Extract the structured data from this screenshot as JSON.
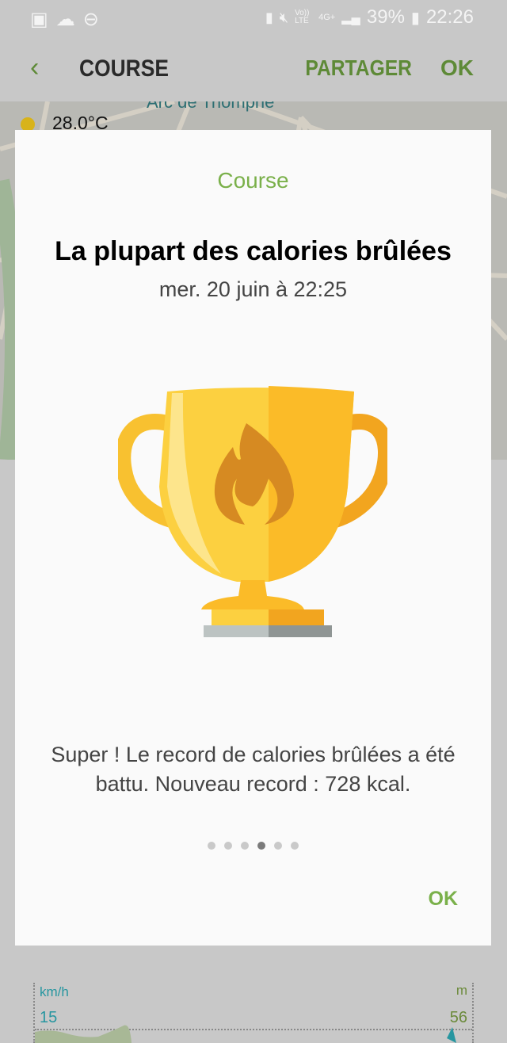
{
  "status_bar": {
    "battery": "39%",
    "time": "22:26",
    "network": "4G+",
    "volte": "Vo)) LTE",
    "icons": [
      "gallery-icon",
      "cloud-icon",
      "dnd-icon",
      "battery-saver-icon",
      "mute-icon",
      "signal-icon",
      "battery-icon"
    ]
  },
  "app_bar": {
    "title": "COURSE",
    "share": "PARTAGER",
    "ok": "OK"
  },
  "map": {
    "temperature": "28.0°C",
    "label": "Arc de Triomphe"
  },
  "dialog": {
    "category": "Course",
    "heading": "La plupart des calories brûlées",
    "date": "mer. 20 juin à 22:25",
    "message": "Super ! Le record de calories brûlées a été battu. Nouveau record : 728 kcal.",
    "ok": "OK",
    "page_count": 6,
    "active_page": 4
  },
  "chart": {
    "left_unit": "km/h",
    "right_unit": "m",
    "left_max": "15",
    "right_max": "56"
  },
  "colors": {
    "accent": "#7ab04a",
    "appbar_accent": "#5e8a37",
    "speed": "#2796a0"
  }
}
